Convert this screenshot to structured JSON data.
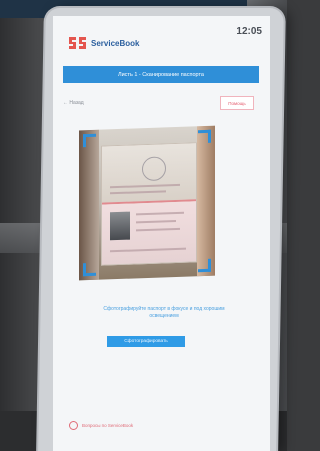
{
  "app": {
    "brand": "ServiceBook",
    "time": "12:05"
  },
  "step": {
    "banner": "Листь 1 - Сканирование паспорта"
  },
  "nav": {
    "back_label": "← Назад",
    "help_label": "Помощь"
  },
  "instruction": {
    "text": "Сфотографируйте паспорт в фокусе и под хорошим освещением"
  },
  "actions": {
    "capture_label": "Сфотографировать"
  },
  "footer": {
    "link_text": "Вопросы по ServiceBook"
  },
  "colors": {
    "accent": "#2f8fd8",
    "danger": "#e45a6c"
  }
}
